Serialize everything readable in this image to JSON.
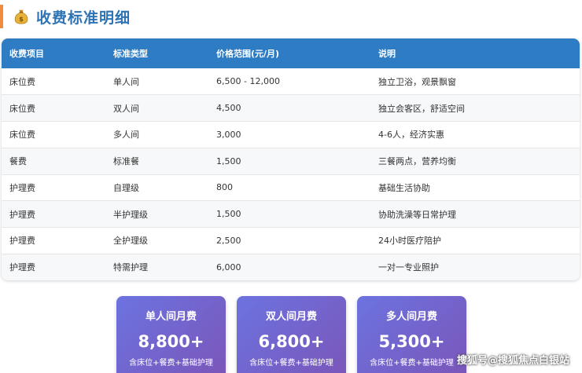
{
  "title": "收费标准明细",
  "icons": {
    "title": "money-bag-icon"
  },
  "colors": {
    "accent_bar": "#f08a3c",
    "title": "#2e74b5",
    "table_header": "#2e7cc4",
    "card_start": "#6c73e0",
    "card_end": "#7b55b8"
  },
  "table": {
    "headers": [
      "收费项目",
      "标准类型",
      "价格范围(元/月)",
      "说明"
    ],
    "rows": [
      [
        "床位费",
        "单人间",
        "6,500 - 12,000",
        "独立卫浴，观景飘窗"
      ],
      [
        "床位费",
        "双人间",
        "4,500",
        "独立会客区，舒适空间"
      ],
      [
        "床位费",
        "多人间",
        "3,000",
        "4-6人，经济实惠"
      ],
      [
        "餐费",
        "标准餐",
        "1,500",
        "三餐两点，营养均衡"
      ],
      [
        "护理费",
        "自理级",
        "800",
        "基础生活协助"
      ],
      [
        "护理费",
        "半护理级",
        "1,500",
        "协助洗澡等日常护理"
      ],
      [
        "护理费",
        "全护理级",
        "2,500",
        "24小时医疗陪护"
      ],
      [
        "护理费",
        "特需护理",
        "6,000",
        "一对一专业照护"
      ]
    ]
  },
  "cards": [
    {
      "title": "单人间月费",
      "price": "8,800+",
      "desc": "含床位+餐费+基础护理"
    },
    {
      "title": "双人间月费",
      "price": "6,800+",
      "desc": "含床位+餐费+基础护理"
    },
    {
      "title": "多人间月费",
      "price": "5,300+",
      "desc": "含床位+餐费+基础护理"
    }
  ],
  "watermark": "搜狐号@搜狐焦点白银站"
}
